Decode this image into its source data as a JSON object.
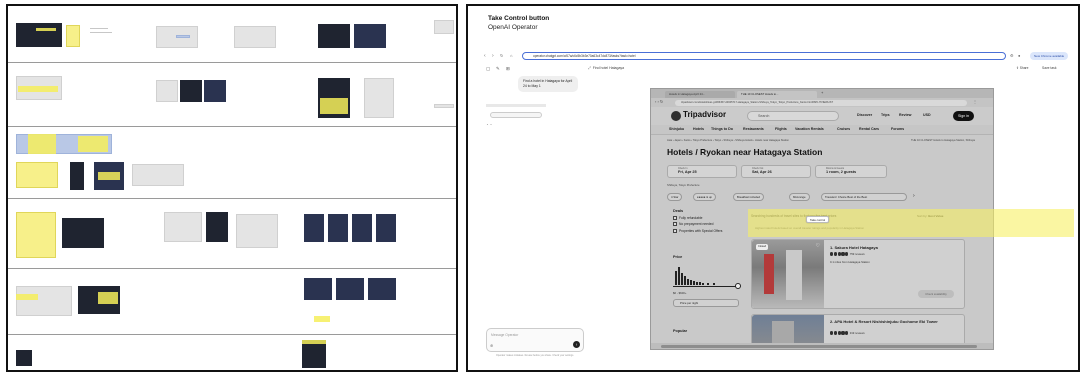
{
  "slide": {
    "title": "Take Control button",
    "subtitle": "OpenAI Operator"
  },
  "operator": {
    "url": "operator.chatgpt.com/c/67a/c6c5b3b3e70a63c47dc873/tasks?task=hotel",
    "new_chrome_label": "New Chrome available",
    "task_title": "Find hotel Hatagaya",
    "share_label": "Share",
    "save_task_label": "Save task",
    "user_message": "Find a hotel in Hatagaya for April 24 to May 1",
    "message_placeholder": "Message Operator",
    "disclaimer": "Operator makes mistakes. Review before you share. Check your settings."
  },
  "browser": {
    "tab1": "Hotels in Hatagaya April 24...",
    "tab2": "THE 10 CLOSEST Hotels to...",
    "url": "tripadvisor.com/HotelsNear-g1066457-d4605717-Hatagaya_Station-Shibuya_Tokyo_Tokyo_Prefecture_Kanto.html#SPLITVIEWLIST"
  },
  "tripadvisor": {
    "logo": "Tripadvisor",
    "search_placeholder": "Search",
    "nav": [
      "Discover",
      "Trips",
      "Review"
    ],
    "currency": "USD",
    "sign_in": "Sign in",
    "categories": [
      "Shinjuku",
      "Hotels",
      "Things to Do",
      "Restaurants",
      "Flights",
      "Vacation Rentals",
      "Cruises",
      "Rental Cars",
      "Forums"
    ],
    "breadcrumbs": "Asia › Japan › Kanto › Tokyo Prefecture › Tokyo › Shibuya › Shibuya Hotels › Hotels near Hatagaya Station",
    "breadcrumbs_right": "THE 10 CLOSEST Hotels to Hatagaya Station, Shibuya",
    "heading": "Hotels / Ryokan near Hatagaya Station",
    "check_in_label": "Check In",
    "check_in": "Fri, Apr 25",
    "check_out_label": "Check Out",
    "check_out": "Sat, Apr 26",
    "guests_label": "Rooms & Guests",
    "guests": "1 room, 2 guests",
    "location": "Shibuya, Tokyo Prefecture",
    "filters": [
      "4 Star",
      "●●●●● & up",
      "Breakfast included",
      "Mid-range",
      "Travelers' Choice Best of the Best"
    ],
    "deals_title": "Deals",
    "deals": [
      "Fully refundable",
      "No prepayment needed",
      "Properties with Special Offers"
    ],
    "price_title": "Price",
    "price_range": "$0 - $600+",
    "price_per_night": "Price per night",
    "popular_title": "Popular",
    "searching_text": "Searching hundreds of travel sites to find you the best prices",
    "sort_by": "Sort by:",
    "sort_value": "Best Value",
    "subline_text": "Highest rated hotels based on overall traveler ratings and popularity in Hatagaya Station",
    "hotel1": {
      "name": "1. Sakura Hotel Hatagaya",
      "reviews": "759 reviews",
      "distance": "0.1 miles from Hatagaya Station",
      "check": "Check availability",
      "badge": "Closed"
    },
    "hotel2": {
      "name": "2. APA Hotel & Resort Nishishinjuku Gochome Eki Tower",
      "reviews": "319 reviews"
    }
  },
  "tooltip": "Take control",
  "colors": {
    "highlight": "#f6ee5a",
    "url_border": "#4a6fd6",
    "new_chrome": "#dbe6fb"
  }
}
